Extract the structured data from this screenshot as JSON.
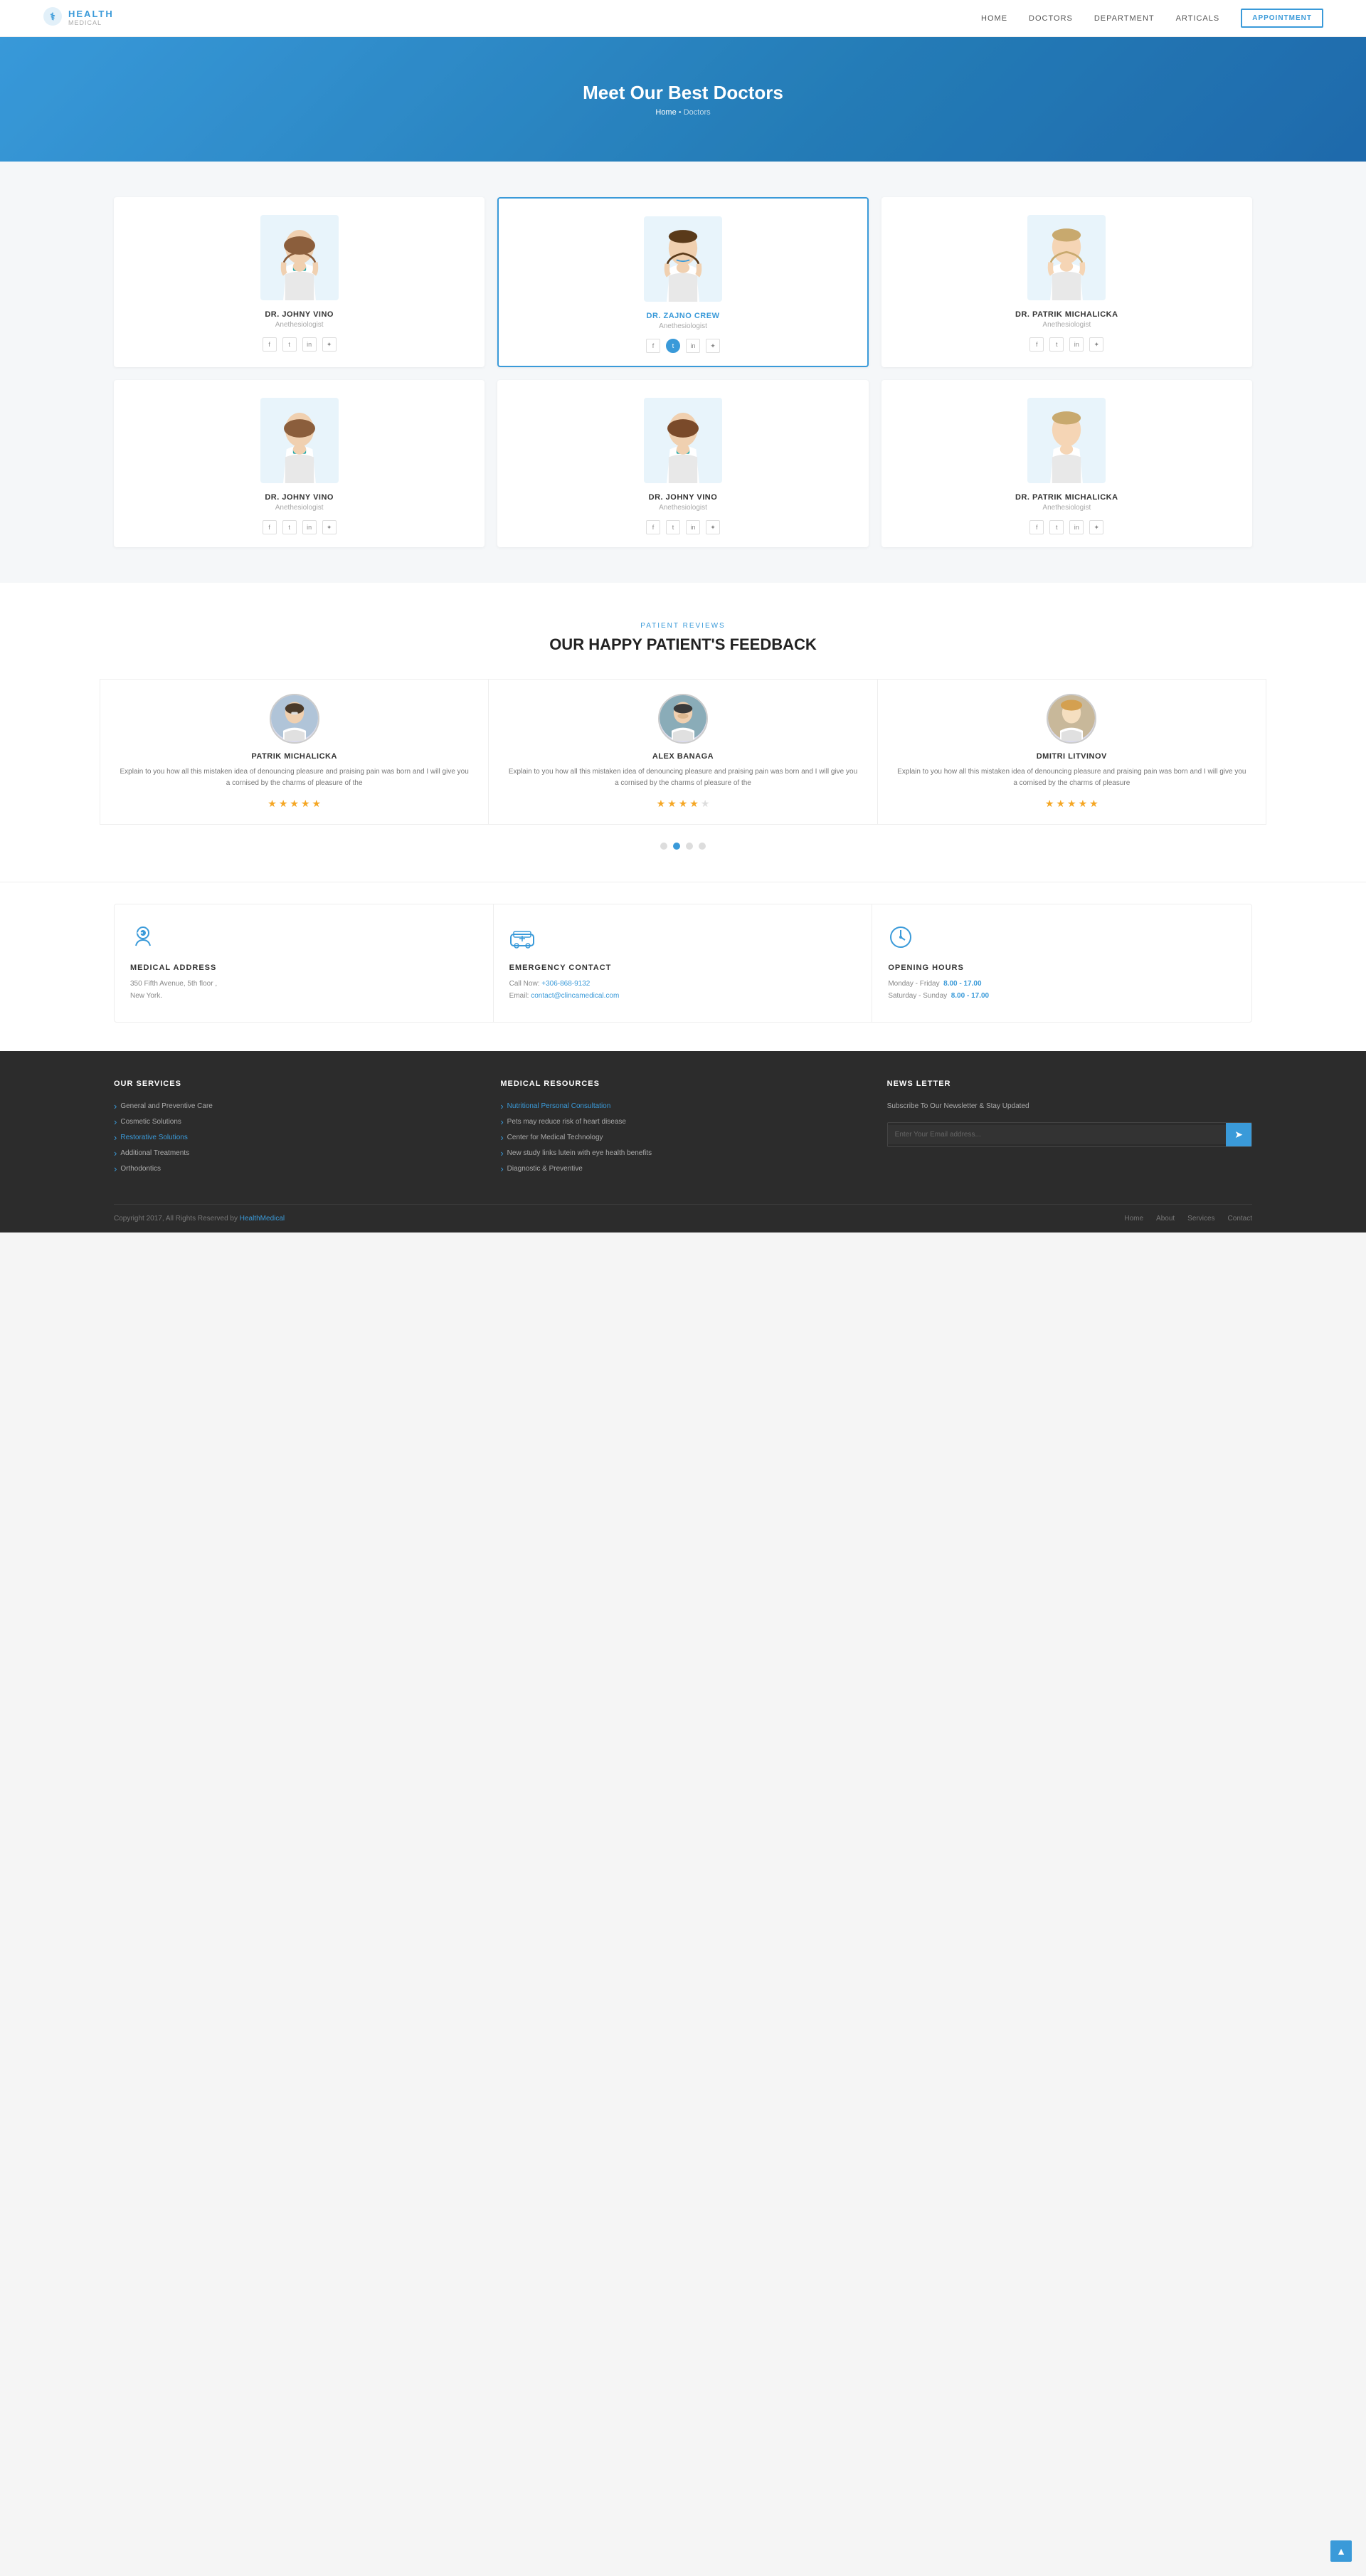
{
  "header": {
    "logo_main": "HEALTH",
    "logo_sub": "MEDICAL",
    "nav": [
      "HOME",
      "DOCTORS",
      "DEPARTMENT",
      "ARTICALS"
    ],
    "appointment_btn": "APPOINTMENT"
  },
  "hero": {
    "title": "Meet Our Best Doctors",
    "breadcrumb_home": "Home",
    "breadcrumb_sep": " • ",
    "breadcrumb_current": "Doctors"
  },
  "doctors": {
    "rows": [
      [
        {
          "name": "DR. JOHNY VINO",
          "specialty": "Anethesiologist",
          "featured": false
        },
        {
          "name": "DR. ZAJNO CREW",
          "specialty": "Anethesiologist",
          "featured": true
        },
        {
          "name": "DR. PATRIK MICHALICKA",
          "specialty": "Anethesiologist",
          "featured": false
        }
      ],
      [
        {
          "name": "DR. JOHNY VINO",
          "specialty": "Anethesiologist",
          "featured": false
        },
        {
          "name": "DR. JOHNY VINO",
          "specialty": "Anethesiologist",
          "featured": false
        },
        {
          "name": "DR. PATRIK MICHALICKA",
          "specialty": "Anethesiologist",
          "featured": false
        }
      ]
    ]
  },
  "reviews": {
    "section_label": "PATIENT REVIEWS",
    "section_title": "OUR HAPPY PATIENT'S FEEDBACK",
    "items": [
      {
        "name": "PATRIK MICHALICKA",
        "text": "Explain to you how all this mistaken idea of denouncing pleasure and praising pain was born and I will give you a cornised by the charms of pleasure of the",
        "stars": 5,
        "gender": "male_glasses"
      },
      {
        "name": "ALEX BANAGA",
        "text": "Explain to you how all this mistaken idea of denouncing pleasure and praising pain was born and I will give you a cornised by the charms of pleasure of the",
        "stars": 4,
        "gender": "male_beard"
      },
      {
        "name": "DMITRI LITVINOV",
        "text": "Explain to you how all this mistaken idea of denouncing pleasure and praising pain was born and I will give you a cornised by the charms of pleasure",
        "stars": 5,
        "gender": "female_blonde"
      }
    ],
    "dots": [
      false,
      true,
      false,
      false
    ]
  },
  "contact": {
    "cards": [
      {
        "icon": "person",
        "title": "MEDICAL ADDRESS",
        "lines": [
          "350 Fifth Avenue, 5th floor ,",
          "New York."
        ]
      },
      {
        "icon": "ambulance",
        "title": "EMERGENCY CONTACT",
        "call_label": "Call Now:",
        "call_number": "+306-868-9132",
        "email_label": "Email:",
        "email_address": "contact@clincamedical.com"
      },
      {
        "icon": "clock",
        "title": "OPENING HOURS",
        "mon_fri": "Monday - Friday",
        "mon_fri_hours": "8.00 - 17.00",
        "sat_sun": "Saturday - Sunday",
        "sat_sun_hours": "8.00 - 17.00"
      }
    ]
  },
  "footer": {
    "services_title": "OUR SERVICES",
    "services": [
      "General and Preventive Care",
      "Cosmetic Solutions",
      "Restorative Solutions",
      "Additional Treatments",
      "Orthodontics"
    ],
    "resources_title": "MEDICAL RESOURCES",
    "resources": [
      "Nutritional Personal Consultation",
      "Pets may reduce risk of heart disease",
      "Center for Medical Technology",
      "New study links lutein with eye health benefits",
      "Diagnostic & Preventive"
    ],
    "newsletter_title": "NEWS LETTER",
    "newsletter_text": "Subscribe To Our Newsletter & Stay Updated",
    "newsletter_placeholder": "Enter Your Email address...",
    "copyright": "Copyright 2017, All Rights Reserved by ",
    "copyright_brand": "HealthMedical",
    "bottom_nav": [
      "Home",
      "About",
      "Services",
      "Contact"
    ]
  }
}
